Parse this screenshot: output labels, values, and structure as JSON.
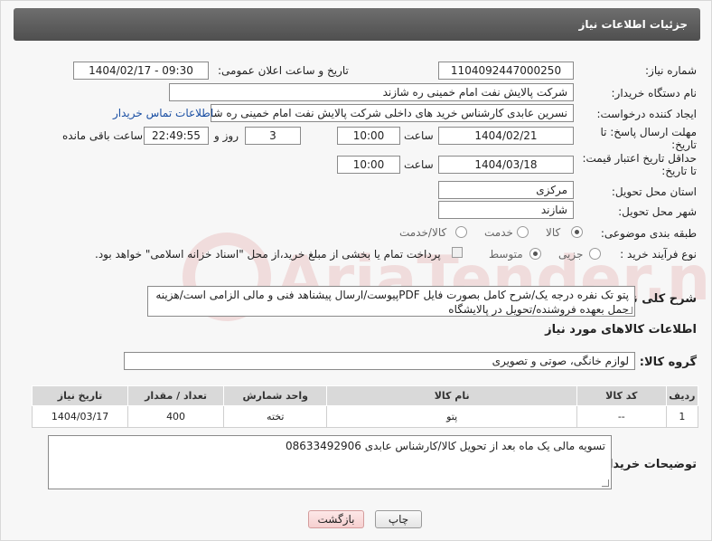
{
  "header": {
    "title": "جزئیات اطلاعات نیاز"
  },
  "fields": {
    "need_number_label": "شماره نیاز:",
    "need_number": "1104092447000250",
    "announce_label": "تاریخ و ساعت اعلان عمومی:",
    "announce_value": "1404/02/17 - 09:30",
    "buyer_org_label": "نام دستگاه خریدار:",
    "buyer_org": "شرکت پالایش نفت امام خمینی  ره  شازند",
    "creator_label": "ایجاد کننده درخواست:",
    "creator": "نسرین عابدی کارشناس خرید های داخلی  شرکت پالایش نفت امام خمینی  ره  شازند",
    "contact_link": "اطلاعات تماس خریدار",
    "deadline_label_1": "مهلت ارسال پاسخ: تا",
    "deadline_label_2": "تاریخ:",
    "deadline_date": "1404/02/21",
    "time_label": "ساعت",
    "deadline_time": "10:00",
    "days_value": "3",
    "days_label": "روز و",
    "remaining_time": "22:49:55",
    "remaining_label": "ساعت باقی مانده",
    "min_price_label_1": "حداقل تاریخ اعتبار قیمت:",
    "min_price_label_2": "تا تاریخ:",
    "price_date": "1404/03/18",
    "price_time": "10:00",
    "province_label": "استان محل تحویل:",
    "province": "مرکزی",
    "city_label": "شهر محل تحویل:",
    "city": "شازند",
    "category_label": "طبقه بندی موضوعی:",
    "category_options": [
      "کالا",
      "خدمت",
      "کالا/خدمت"
    ],
    "process_label": "نوع فرآیند خرید :",
    "process_options": [
      "جزیی",
      "متوسط"
    ],
    "payment_text": "پرداخت تمام یا بخشی از مبلغ خرید،از محل \"اسناد خزانه اسلامی\" خواهد بود.",
    "description_label": "شرح کلی نیاز:",
    "description": "پتو تک نفره درجه یک/شرح کامل بصورت فایل PDFپیوست/ارسال پیشناهد فنی و مالی الزامی است/هزینه حمل بعهده فروشنده/تحویل در پالایشگاه",
    "goods_info_title": "اطلاعات کالاهای مورد نیاز",
    "goods_group_label": "گروه کالا:",
    "goods_group": "لوازم خانگی، صوتی و تصویری",
    "buyer_notes_label": "توضیحات خریدار:",
    "buyer_notes": "تسویه مالی یک ماه بعد از تحویل کالا/کارشناس عابدی 08633492906"
  },
  "table": {
    "headers": [
      "ردیف",
      "کد کالا",
      "نام کالا",
      "واحد شمارش",
      "تعداد / مقدار",
      "تاریخ نیاز"
    ],
    "rows": [
      [
        "1",
        "--",
        "پتو",
        "تخته",
        "400",
        "1404/03/17"
      ]
    ]
  },
  "buttons": {
    "print": "چاپ",
    "back": "بازگشت"
  },
  "watermark": "AriaTender.neT"
}
